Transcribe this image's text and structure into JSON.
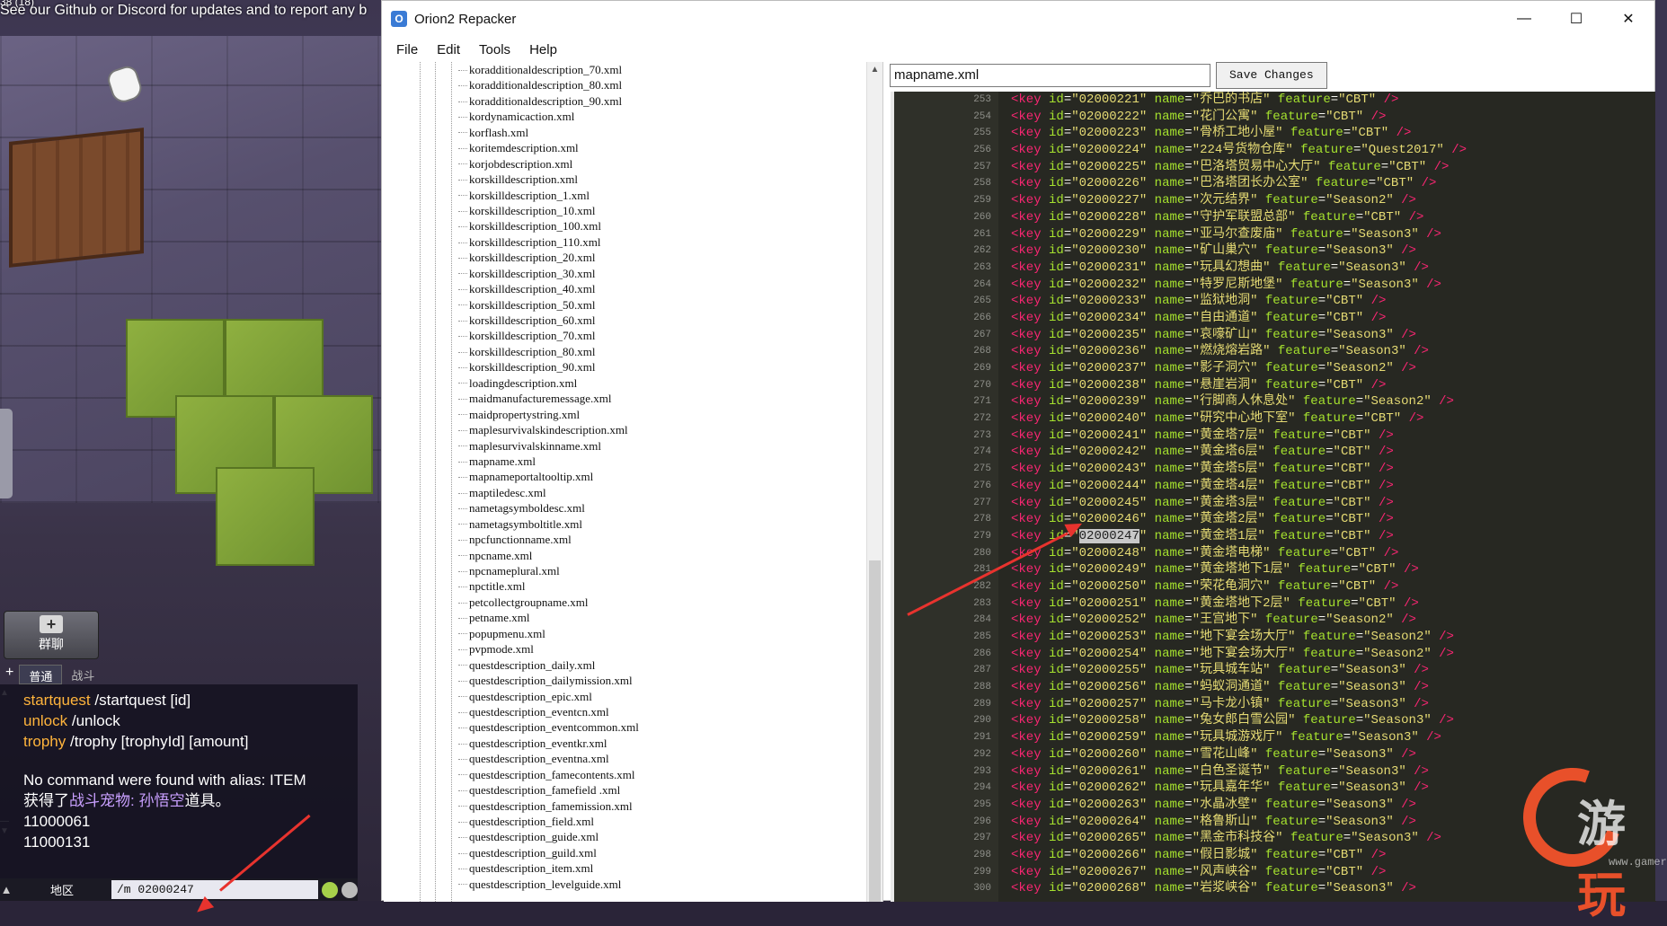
{
  "game": {
    "banner": "See our Github or Discord for updates and to report any b",
    "top_num": "38 (18)",
    "group_button": "群聊",
    "chat_tabs": [
      "普通",
      "战斗"
    ],
    "chat_lines": [
      {
        "cmd": "startquest",
        "rest": " /startquest [id]"
      },
      {
        "cmd": "unlock",
        "rest": " /unlock"
      },
      {
        "cmd": "trophy",
        "rest": " /trophy [trophyId] [amount]"
      }
    ],
    "chat_msg_1": "No command were found with alias: ITEM",
    "chat_msg_2_pre": "获得了",
    "chat_msg_2_highlight": "战斗宠物: 孙悟空",
    "chat_msg_2_post": "道具。",
    "chat_msg_3": "11000061",
    "chat_msg_4": "11000131",
    "chat_region": "地区",
    "chat_input": "/m 02000247"
  },
  "window": {
    "title": "Orion2 Repacker",
    "min_icon": "—",
    "max_icon": "☐",
    "close_icon": "✕",
    "menu": [
      "File",
      "Edit",
      "Tools",
      "Help"
    ],
    "filename": "mapname.xml",
    "save_label": "Save Changes"
  },
  "tree_files": [
    "koradditionaldescription_70.xml",
    "koradditionaldescription_80.xml",
    "koradditionaldescription_90.xml",
    "kordynamicaction.xml",
    "korflash.xml",
    "koritemdescription.xml",
    "korjobdescription.xml",
    "korskilldescription.xml",
    "korskilldescription_1.xml",
    "korskilldescription_10.xml",
    "korskilldescription_100.xml",
    "korskilldescription_110.xml",
    "korskilldescription_20.xml",
    "korskilldescription_30.xml",
    "korskilldescription_40.xml",
    "korskilldescription_50.xml",
    "korskilldescription_60.xml",
    "korskilldescription_70.xml",
    "korskilldescription_80.xml",
    "korskilldescription_90.xml",
    "loadingdescription.xml",
    "maidmanufacturemessage.xml",
    "maidpropertystring.xml",
    "maplesurvivalskindescription.xml",
    "maplesurvivalskinname.xml",
    "mapname.xml",
    "mapnameportaltooltip.xml",
    "maptiledesc.xml",
    "nametagsymboldesc.xml",
    "nametagsymboltitle.xml",
    "npcfunctionname.xml",
    "npcname.xml",
    "npcnameplural.xml",
    "npctitle.xml",
    "petcollectgroupname.xml",
    "petname.xml",
    "popupmenu.xml",
    "pvpmode.xml",
    "questdescription_daily.xml",
    "questdescription_dailymission.xml",
    "questdescription_epic.xml",
    "questdescription_eventcn.xml",
    "questdescription_eventcommon.xml",
    "questdescription_eventkr.xml",
    "questdescription_eventna.xml",
    "questdescription_famecontents.xml",
    "questdescription_famefield .xml",
    "questdescription_famemission.xml",
    "questdescription_field.xml",
    "questdescription_guide.xml",
    "questdescription_guild.xml",
    "questdescription_item.xml",
    "questdescription_levelguide.xml"
  ],
  "code_rows": [
    {
      "ln": "253",
      "id": "02000221",
      "name": "乔巴的书店",
      "feature": "CBT"
    },
    {
      "ln": "254",
      "id": "02000222",
      "name": "花门公寓",
      "feature": "CBT"
    },
    {
      "ln": "255",
      "id": "02000223",
      "name": "骨桥工地小屋",
      "feature": "CBT"
    },
    {
      "ln": "256",
      "id": "02000224",
      "name": "224号货物仓库",
      "feature": "Quest2017"
    },
    {
      "ln": "257",
      "id": "02000225",
      "name": "巴洛塔贸易中心大厅",
      "feature": "CBT"
    },
    {
      "ln": "258",
      "id": "02000226",
      "name": "巴洛塔团长办公室",
      "feature": "CBT"
    },
    {
      "ln": "259",
      "id": "02000227",
      "name": "次元结界",
      "feature": "Season2"
    },
    {
      "ln": "260",
      "id": "02000228",
      "name": "守护军联盟总部",
      "feature": "CBT"
    },
    {
      "ln": "261",
      "id": "02000229",
      "name": "亚马尔查废庙",
      "feature": "Season3"
    },
    {
      "ln": "262",
      "id": "02000230",
      "name": "矿山巢穴",
      "feature": "Season3"
    },
    {
      "ln": "263",
      "id": "02000231",
      "name": "玩具幻想曲",
      "feature": "Season3"
    },
    {
      "ln": "264",
      "id": "02000232",
      "name": "特罗尼斯地堡",
      "feature": "Season3"
    },
    {
      "ln": "265",
      "id": "02000233",
      "name": "监狱地洞",
      "feature": "CBT"
    },
    {
      "ln": "266",
      "id": "02000234",
      "name": "自由通道",
      "feature": "CBT"
    },
    {
      "ln": "267",
      "id": "02000235",
      "name": "哀嚎矿山",
      "feature": "Season3"
    },
    {
      "ln": "268",
      "id": "02000236",
      "name": "燃烧熔岩路",
      "feature": "Season3"
    },
    {
      "ln": "269",
      "id": "02000237",
      "name": "影子洞穴",
      "feature": "Season2"
    },
    {
      "ln": "270",
      "id": "02000238",
      "name": "悬崖岩洞",
      "feature": "CBT"
    },
    {
      "ln": "271",
      "id": "02000239",
      "name": "行脚商人休息处",
      "feature": "Season2"
    },
    {
      "ln": "272",
      "id": "02000240",
      "name": "研究中心地下室",
      "feature": "CBT"
    },
    {
      "ln": "273",
      "id": "02000241",
      "name": "黄金塔7层",
      "feature": "CBT"
    },
    {
      "ln": "274",
      "id": "02000242",
      "name": "黄金塔6层",
      "feature": "CBT"
    },
    {
      "ln": "275",
      "id": "02000243",
      "name": "黄金塔5层",
      "feature": "CBT"
    },
    {
      "ln": "276",
      "id": "02000244",
      "name": "黄金塔4层",
      "feature": "CBT"
    },
    {
      "ln": "277",
      "id": "02000245",
      "name": "黄金塔3层",
      "feature": "CBT"
    },
    {
      "ln": "278",
      "id": "02000246",
      "name": "黄金塔2层",
      "feature": "CBT"
    },
    {
      "ln": "279",
      "id": "02000247",
      "name": "黄金塔1层",
      "feature": "CBT",
      "selected": true
    },
    {
      "ln": "280",
      "id": "02000248",
      "name": "黄金塔电梯",
      "feature": "CBT"
    },
    {
      "ln": "281",
      "id": "02000249",
      "name": "黄金塔地下1层",
      "feature": "CBT"
    },
    {
      "ln": "282",
      "id": "02000250",
      "name": "荣花龟洞穴",
      "feature": "CBT"
    },
    {
      "ln": "283",
      "id": "02000251",
      "name": "黄金塔地下2层",
      "feature": "CBT"
    },
    {
      "ln": "284",
      "id": "02000252",
      "name": "王宫地下",
      "feature": "Season2"
    },
    {
      "ln": "285",
      "id": "02000253",
      "name": "地下宴会场大厅",
      "feature": "Season2"
    },
    {
      "ln": "286",
      "id": "02000254",
      "name": "地下宴会场大厅",
      "feature": "Season2"
    },
    {
      "ln": "287",
      "id": "02000255",
      "name": "玩具城车站",
      "feature": "Season3"
    },
    {
      "ln": "288",
      "id": "02000256",
      "name": "蚂蚁洞通道",
      "feature": "Season3"
    },
    {
      "ln": "289",
      "id": "02000257",
      "name": "马卡龙小镇",
      "feature": "Season3"
    },
    {
      "ln": "290",
      "id": "02000258",
      "name": "兔女郎白雪公园",
      "feature": "Season3"
    },
    {
      "ln": "291",
      "id": "02000259",
      "name": "玩具城游戏厅",
      "feature": "Season3"
    },
    {
      "ln": "292",
      "id": "02000260",
      "name": "雪花山峰",
      "feature": "Season3"
    },
    {
      "ln": "293",
      "id": "02000261",
      "name": "白色圣诞节",
      "feature": "Season3"
    },
    {
      "ln": "294",
      "id": "02000262",
      "name": "玩具嘉年华",
      "feature": "Season3"
    },
    {
      "ln": "295",
      "id": "02000263",
      "name": "水晶冰壁",
      "feature": "Season3"
    },
    {
      "ln": "296",
      "id": "02000264",
      "name": "格鲁斯山",
      "feature": "Season3"
    },
    {
      "ln": "297",
      "id": "02000265",
      "name": "黑金市科技谷",
      "feature": "Season3"
    },
    {
      "ln": "298",
      "id": "02000266",
      "name": "假日影城",
      "feature": "CBT"
    },
    {
      "ln": "299",
      "id": "02000267",
      "name": "风声峡谷",
      "feature": "CBT"
    },
    {
      "ln": "300",
      "id": "02000268",
      "name": "岩浆峡谷",
      "feature": "Season3"
    }
  ],
  "watermark": {
    "text_a": "游",
    "text_b": "玩",
    "url": "www.gamersky.com"
  }
}
